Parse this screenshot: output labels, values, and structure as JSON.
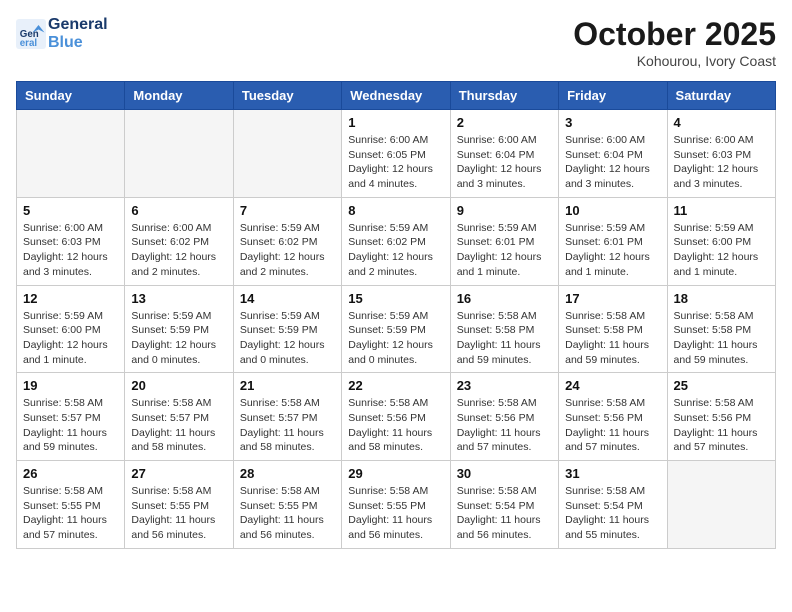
{
  "header": {
    "logo_line1": "General",
    "logo_line2": "Blue",
    "month": "October 2025",
    "location": "Kohourou, Ivory Coast"
  },
  "weekdays": [
    "Sunday",
    "Monday",
    "Tuesday",
    "Wednesday",
    "Thursday",
    "Friday",
    "Saturday"
  ],
  "weeks": [
    [
      {
        "day": "",
        "info": ""
      },
      {
        "day": "",
        "info": ""
      },
      {
        "day": "",
        "info": ""
      },
      {
        "day": "1",
        "info": "Sunrise: 6:00 AM\nSunset: 6:05 PM\nDaylight: 12 hours\nand 4 minutes."
      },
      {
        "day": "2",
        "info": "Sunrise: 6:00 AM\nSunset: 6:04 PM\nDaylight: 12 hours\nand 3 minutes."
      },
      {
        "day": "3",
        "info": "Sunrise: 6:00 AM\nSunset: 6:04 PM\nDaylight: 12 hours\nand 3 minutes."
      },
      {
        "day": "4",
        "info": "Sunrise: 6:00 AM\nSunset: 6:03 PM\nDaylight: 12 hours\nand 3 minutes."
      }
    ],
    [
      {
        "day": "5",
        "info": "Sunrise: 6:00 AM\nSunset: 6:03 PM\nDaylight: 12 hours\nand 3 minutes."
      },
      {
        "day": "6",
        "info": "Sunrise: 6:00 AM\nSunset: 6:02 PM\nDaylight: 12 hours\nand 2 minutes."
      },
      {
        "day": "7",
        "info": "Sunrise: 5:59 AM\nSunset: 6:02 PM\nDaylight: 12 hours\nand 2 minutes."
      },
      {
        "day": "8",
        "info": "Sunrise: 5:59 AM\nSunset: 6:02 PM\nDaylight: 12 hours\nand 2 minutes."
      },
      {
        "day": "9",
        "info": "Sunrise: 5:59 AM\nSunset: 6:01 PM\nDaylight: 12 hours\nand 1 minute."
      },
      {
        "day": "10",
        "info": "Sunrise: 5:59 AM\nSunset: 6:01 PM\nDaylight: 12 hours\nand 1 minute."
      },
      {
        "day": "11",
        "info": "Sunrise: 5:59 AM\nSunset: 6:00 PM\nDaylight: 12 hours\nand 1 minute."
      }
    ],
    [
      {
        "day": "12",
        "info": "Sunrise: 5:59 AM\nSunset: 6:00 PM\nDaylight: 12 hours\nand 1 minute."
      },
      {
        "day": "13",
        "info": "Sunrise: 5:59 AM\nSunset: 5:59 PM\nDaylight: 12 hours\nand 0 minutes."
      },
      {
        "day": "14",
        "info": "Sunrise: 5:59 AM\nSunset: 5:59 PM\nDaylight: 12 hours\nand 0 minutes."
      },
      {
        "day": "15",
        "info": "Sunrise: 5:59 AM\nSunset: 5:59 PM\nDaylight: 12 hours\nand 0 minutes."
      },
      {
        "day": "16",
        "info": "Sunrise: 5:58 AM\nSunset: 5:58 PM\nDaylight: 11 hours\nand 59 minutes."
      },
      {
        "day": "17",
        "info": "Sunrise: 5:58 AM\nSunset: 5:58 PM\nDaylight: 11 hours\nand 59 minutes."
      },
      {
        "day": "18",
        "info": "Sunrise: 5:58 AM\nSunset: 5:58 PM\nDaylight: 11 hours\nand 59 minutes."
      }
    ],
    [
      {
        "day": "19",
        "info": "Sunrise: 5:58 AM\nSunset: 5:57 PM\nDaylight: 11 hours\nand 59 minutes."
      },
      {
        "day": "20",
        "info": "Sunrise: 5:58 AM\nSunset: 5:57 PM\nDaylight: 11 hours\nand 58 minutes."
      },
      {
        "day": "21",
        "info": "Sunrise: 5:58 AM\nSunset: 5:57 PM\nDaylight: 11 hours\nand 58 minutes."
      },
      {
        "day": "22",
        "info": "Sunrise: 5:58 AM\nSunset: 5:56 PM\nDaylight: 11 hours\nand 58 minutes."
      },
      {
        "day": "23",
        "info": "Sunrise: 5:58 AM\nSunset: 5:56 PM\nDaylight: 11 hours\nand 57 minutes."
      },
      {
        "day": "24",
        "info": "Sunrise: 5:58 AM\nSunset: 5:56 PM\nDaylight: 11 hours\nand 57 minutes."
      },
      {
        "day": "25",
        "info": "Sunrise: 5:58 AM\nSunset: 5:56 PM\nDaylight: 11 hours\nand 57 minutes."
      }
    ],
    [
      {
        "day": "26",
        "info": "Sunrise: 5:58 AM\nSunset: 5:55 PM\nDaylight: 11 hours\nand 57 minutes."
      },
      {
        "day": "27",
        "info": "Sunrise: 5:58 AM\nSunset: 5:55 PM\nDaylight: 11 hours\nand 56 minutes."
      },
      {
        "day": "28",
        "info": "Sunrise: 5:58 AM\nSunset: 5:55 PM\nDaylight: 11 hours\nand 56 minutes."
      },
      {
        "day": "29",
        "info": "Sunrise: 5:58 AM\nSunset: 5:55 PM\nDaylight: 11 hours\nand 56 minutes."
      },
      {
        "day": "30",
        "info": "Sunrise: 5:58 AM\nSunset: 5:54 PM\nDaylight: 11 hours\nand 56 minutes."
      },
      {
        "day": "31",
        "info": "Sunrise: 5:58 AM\nSunset: 5:54 PM\nDaylight: 11 hours\nand 55 minutes."
      },
      {
        "day": "",
        "info": ""
      }
    ]
  ]
}
